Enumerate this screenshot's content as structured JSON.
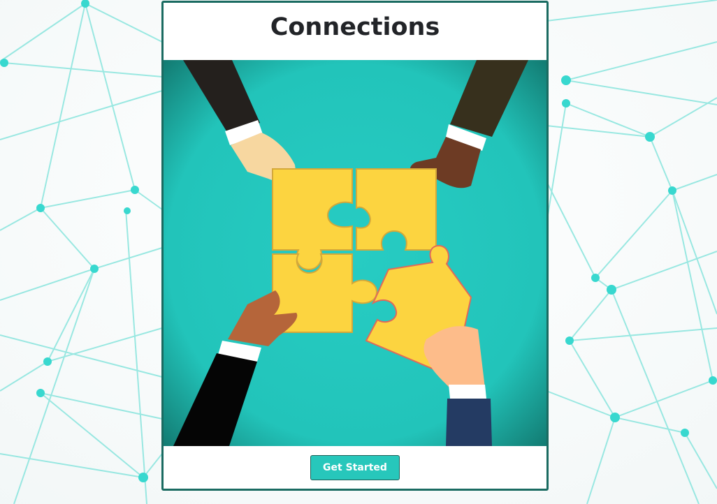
{
  "page": {
    "title": "Connections"
  },
  "hero": {
    "icon": "puzzle-hands-illustration",
    "background_color": "#25c7be"
  },
  "actions": {
    "get_started_label": "Get Started"
  },
  "theme": {
    "accent": "#27c7bb",
    "border": "#1a6b61",
    "network_line": "#7fe3dc",
    "network_node": "#38d8cf"
  }
}
